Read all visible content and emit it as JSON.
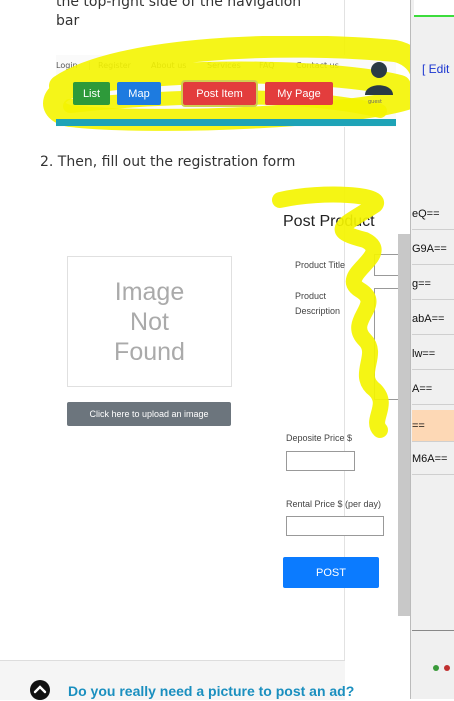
{
  "doc": {
    "intro_line1": "the top-right side of the navigation",
    "intro_line2": "bar",
    "step2": "2. Then, fill out the registration form",
    "faq_question": "Do you really need a picture to post an ad?"
  },
  "navbar_shot": {
    "top_links": [
      "Login",
      "Register",
      "About us",
      "Services",
      "FAQ",
      "Contact us"
    ],
    "buttons": {
      "list": "List",
      "map": "Map",
      "post_item": "Post Item",
      "my_page": "My Page"
    },
    "avatar_caption": "guest",
    "colors": {
      "list": "#2e9a3a",
      "map": "#1d7be0",
      "post_item": "#e33d3d",
      "my_page": "#e33d3d",
      "teal": "#1ea3b7",
      "highlight": "#f4f400"
    }
  },
  "form_shot": {
    "title": "Post Product",
    "image_placeholder": [
      "Image",
      "Not",
      "Found"
    ],
    "upload_button": "Click here to upload an image",
    "product_title_label": "Product Title",
    "product_description_label": [
      "Product",
      "Description"
    ],
    "deposit_label": "Deposite Price $",
    "rental_label": "Rental Price $ (per day)",
    "post_button": "POST"
  },
  "right_window": {
    "edit_link": "[ Edit",
    "cells": [
      "eQ==",
      "G9A==",
      "g==",
      "abA==",
      "lw==",
      "A==",
      "==",
      "M6A=="
    ],
    "highlight_color": "#fdd8b5"
  }
}
